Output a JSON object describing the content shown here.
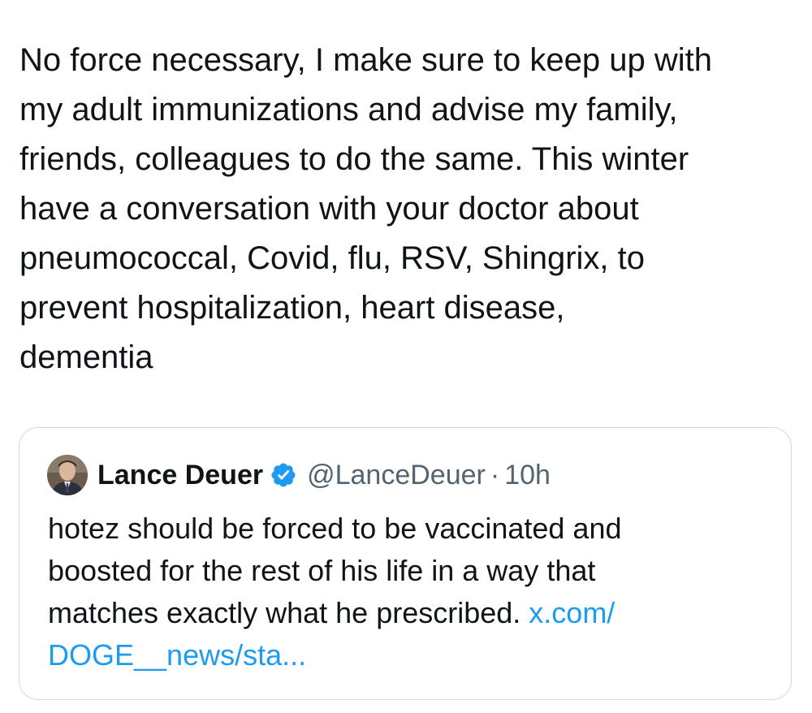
{
  "tweet": {
    "text_lines": [
      "No force necessary, I make sure to keep up with",
      "my adult immunizations and advise my family,",
      "friends, colleagues to do the same. This winter",
      "have a conversation with your doctor about",
      "pneumococcal, Covid, flu, RSV, Shingrix, to",
      "prevent hospitalization, heart disease,",
      "dementia"
    ]
  },
  "quote": {
    "author_name": "Lance Deuer",
    "handle": "@LanceDeuer",
    "separator": "·",
    "time": "10h",
    "text_lines": [
      "hotez should be forced to be vaccinated and",
      "boosted for the rest of his life in a way that",
      "matches exactly what he prescribed."
    ],
    "link_line1": "x.com/",
    "link_line2": "DOGE__news/sta..."
  },
  "colors": {
    "text": "#0f1419",
    "secondary_text": "#536471",
    "link": "#1d9bf0",
    "verified_badge": "#1d9bf0",
    "card_border": "#cfd9de"
  },
  "icons": {
    "verified": "verified-badge-icon",
    "avatar": "user-avatar"
  }
}
